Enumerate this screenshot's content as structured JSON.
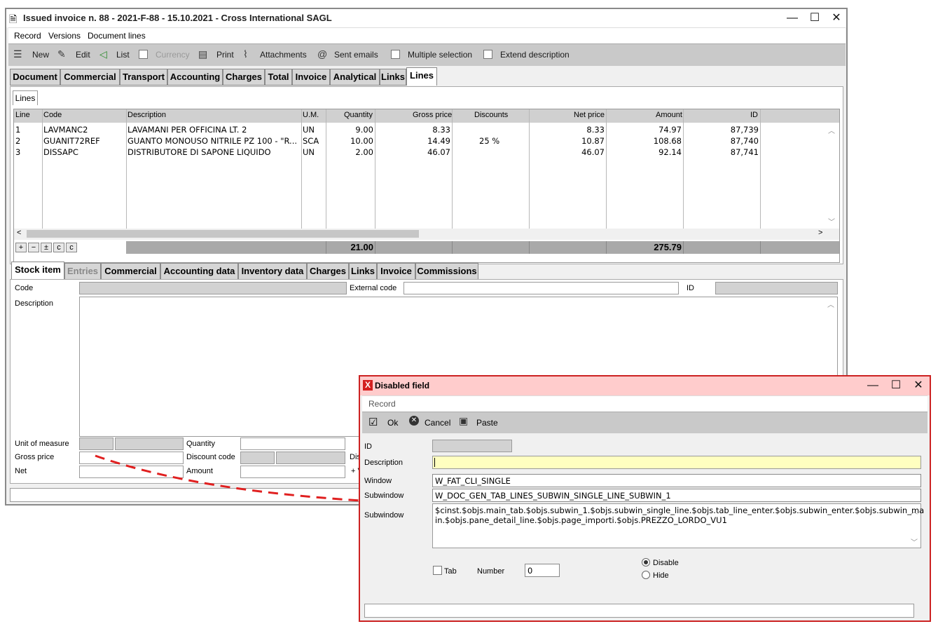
{
  "main_window": {
    "title": "Issued invoice n. 88 - 2021-F-88  -  15.10.2021  -  Cross International SAGL",
    "menu": [
      "Record",
      "Versions",
      "Document lines"
    ],
    "toolbar": {
      "new": "New",
      "edit": "Edit",
      "list": "List",
      "currency": "Currency",
      "print": "Print",
      "attachments": "Attachments",
      "sent_emails": "Sent emails",
      "multiple_selection": "Multiple selection",
      "extend_description": "Extend description"
    },
    "tabs": [
      "Document",
      "Commercial",
      "Transport",
      "Accounting",
      "Charges",
      "Total",
      "Invoice",
      "Analytical",
      "Links",
      "Lines"
    ],
    "active_tab": "Lines",
    "subtab": "Lines",
    "grid": {
      "columns": [
        "Line",
        "Code",
        "Description",
        "U.M.",
        "Quantity",
        "Gross price",
        "Discounts",
        "Net price",
        "Amount",
        "ID"
      ],
      "rows": [
        [
          "1",
          "LAVMANC2",
          "LAVAMANI PER OFFICINA LT. 2",
          "UN",
          "9.00",
          "8.33",
          "",
          "8.33",
          "74.97",
          "87,739"
        ],
        [
          "2",
          "GUANIT72REF",
          "GUANTO MONOUSO NITRILE PZ 100 - \"R...",
          "SCA",
          "10.00",
          "14.49",
          "25 %",
          "10.87",
          "108.68",
          "87,740"
        ],
        [
          "3",
          "DISSAPC",
          "DISTRIBUTORE DI SAPONE LIQUIDO",
          "UN",
          "2.00",
          "46.07",
          "",
          "46.07",
          "92.14",
          "87,741"
        ]
      ],
      "total_quantity": "21.00",
      "total_amount": "275.79"
    },
    "detail_tabs": [
      "Stock item",
      "Entries",
      "Commercial",
      "Accounting data",
      "Inventory data",
      "Charges",
      "Links",
      "Invoice",
      "Commissions"
    ],
    "detail": {
      "code_label": "Code",
      "external_code_label": "External code",
      "id_label": "ID",
      "description_label": "Description",
      "unit_label": "Unit of measure",
      "quantity_label": "Quantity",
      "gross_price_label": "Gross price",
      "discount_code_label": "Discount code",
      "net_label": "Net",
      "amount_label": "Amount",
      "dis_label": "Dis",
      "plus_label": "+ V"
    }
  },
  "dialog": {
    "title": "Disabled field",
    "menu": "Record",
    "toolbar": {
      "ok": "Ok",
      "cancel": "Cancel",
      "paste": "Paste"
    },
    "labels": {
      "id": "ID",
      "description": "Description",
      "window": "Window",
      "subwindow": "Subwindow",
      "subwindow2": "Subwindow",
      "tab": "Tab",
      "number": "Number",
      "disable": "Disable",
      "hide": "Hide"
    },
    "values": {
      "window": "W_FAT_CLI_SINGLE",
      "subwindow": "W_DOC_GEN_TAB_LINES_SUBWIN_SINGLE_LINE_SUBWIN_1",
      "path_line1": "$cinst.$objs.main_tab.$objs.subwin_1.$objs.subwin_single_line.$objs.tab_line_enter.$objs.subwin_enter.$objs.subwin_ma",
      "path_line2": "in.$objs.pane_detail_line.$objs.page_importi.$objs.PREZZO_LORDO_VU1",
      "number": "0"
    }
  },
  "colors": {
    "dialog_border": "#cc2222",
    "dialog_title_bg": "#ffcccc",
    "arrow": "#e02020",
    "description_field": "#ffffc0"
  }
}
